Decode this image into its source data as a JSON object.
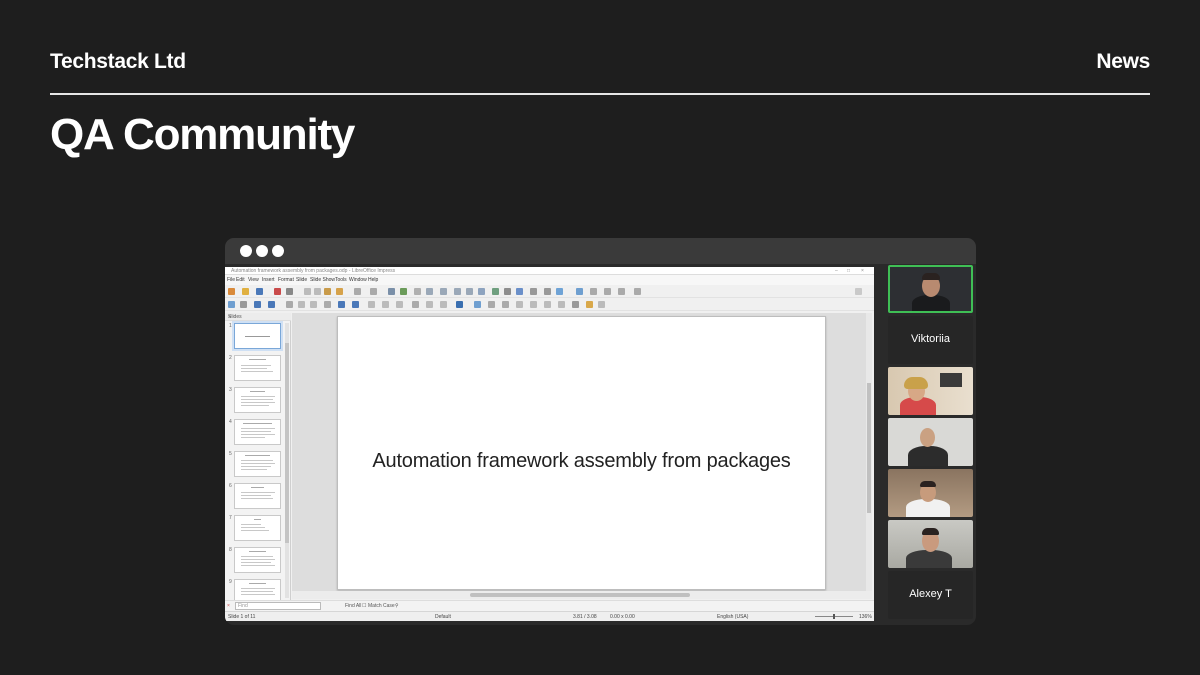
{
  "header": {
    "brand": "Techstack Ltd",
    "nav_link": "News",
    "headline": "QA Community"
  },
  "app": {
    "window_title": "Automation framework assembly from packages.odp - LibreOffice Impress",
    "menu": [
      "File",
      "Edit",
      "View",
      "Insert",
      "Format",
      "Slide",
      "Slide Show",
      "Tools",
      "Window",
      "Help"
    ],
    "slides_panel_label": "Slides",
    "slide_numbers": [
      "1",
      "2",
      "3",
      "4",
      "5",
      "6",
      "7",
      "8",
      "9"
    ],
    "current_slide_title": "Automation framework assembly from packages",
    "find_placeholder": "Find",
    "find_all": "Find All",
    "match_case": "Match Case",
    "status": {
      "slide_count": "Slide 1 of 11",
      "layout": "Default",
      "position": "3.81 / 3.08",
      "size": "0.00 x 0.00",
      "language": "English (USA)",
      "zoom": "136%"
    }
  },
  "participants": [
    {
      "type": "video",
      "active": true
    },
    {
      "type": "name",
      "name": "Viktoriia"
    },
    {
      "type": "video"
    },
    {
      "type": "video"
    },
    {
      "type": "video"
    },
    {
      "type": "video"
    },
    {
      "type": "name",
      "name": "Alexey T"
    }
  ],
  "colors": {
    "background": "#1e1e1e",
    "active_speaker_border": "#3fbf55"
  }
}
